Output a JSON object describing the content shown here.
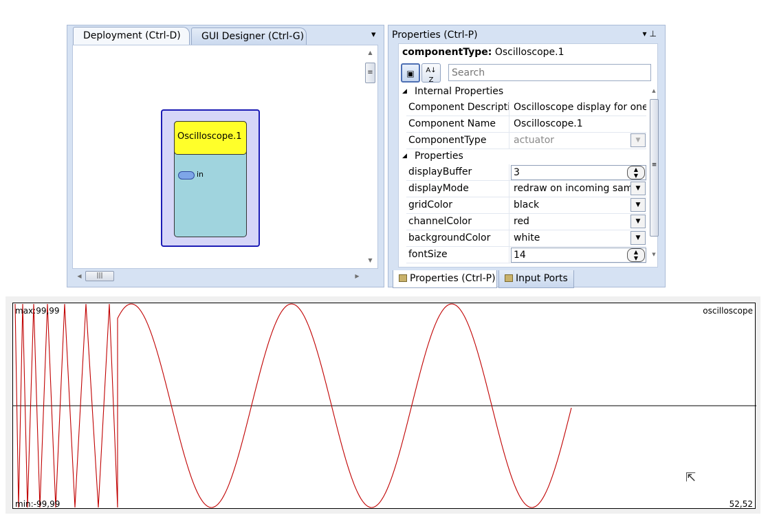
{
  "deployment": {
    "tabs": [
      {
        "label": "Deployment (Ctrl-D)"
      },
      {
        "label": "GUI Designer (Ctrl-G)"
      }
    ],
    "component": {
      "title": "Oscilloscope.1",
      "port_label": "in"
    }
  },
  "properties": {
    "panel_title": "Properties (Ctrl-P)",
    "component_type_label": "componentType:",
    "component_type_value": "Oscilloscope.1",
    "search_placeholder": "Search",
    "categories": [
      {
        "label": "Internal Properties"
      },
      {
        "label": "Properties"
      }
    ],
    "rows": [
      {
        "name": "Component Descriptic",
        "value": "Oscilloscope display for one"
      },
      {
        "name": "Component Name",
        "value": "Oscilloscope.1"
      },
      {
        "name": "ComponentType",
        "value": "actuator"
      },
      {
        "name": "displayBuffer",
        "value": "3"
      },
      {
        "name": "displayMode",
        "value": "redraw on incoming sam"
      },
      {
        "name": "gridColor",
        "value": "black"
      },
      {
        "name": "channelColor",
        "value": "red"
      },
      {
        "name": "backgroundColor",
        "value": "white"
      },
      {
        "name": "fontSize",
        "value": "14"
      }
    ],
    "bottom_tabs": [
      {
        "label": "Properties (Ctrl-P)"
      },
      {
        "label": "Input Ports"
      }
    ]
  },
  "scope": {
    "max_label": "max:99,99",
    "min_label": "min:-99,99",
    "name_label": "oscilloscope",
    "value_label": "52,52",
    "trace_color": "#c00000",
    "grid_color": "#000000",
    "background_color": "#ffffff"
  }
}
